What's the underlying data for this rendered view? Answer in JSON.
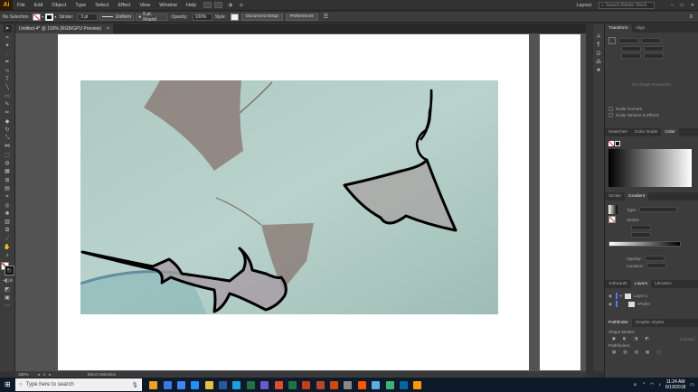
{
  "app": {
    "logo": "Ai",
    "menu": [
      "File",
      "Edit",
      "Object",
      "Type",
      "Select",
      "Effect",
      "View",
      "Window",
      "Help"
    ],
    "workspace": "Layout",
    "search_placeholder": "Search Adobe Stock"
  },
  "control": {
    "selection": "No Selection",
    "stroke_label": "Stroke:",
    "stroke_weight": "3 pt",
    "stroke_profile": "Uniform",
    "brush": "5 pt. Round",
    "opacity_label": "Opacity:",
    "opacity_value": "100%",
    "style_label": "Style:",
    "document_setup": "Document Setup",
    "preferences": "Preferences"
  },
  "document_tab": {
    "title": "Untitled-4* @ 150% (RGB/GPU Preview)",
    "close": "×"
  },
  "status": {
    "zoom": "150%",
    "artboard": "1",
    "tool": "Direct Selection"
  },
  "panels": {
    "transform_tabs": [
      "Transform",
      "Align"
    ],
    "transform_empty": "No Shape Properties",
    "scale_corners": "Scale Corners",
    "scale_strokes": "Scale Strokes & Effects",
    "color_tabs": [
      "Swatches",
      "Color Guide",
      "Color"
    ],
    "stroke_tabs": [
      "Stroke",
      "Gradient"
    ],
    "gradient_type": "Type:",
    "gradient_stroke": "Stroke:",
    "gradient_opacity": "Opacity:",
    "gradient_location": "Location:",
    "layers_tabs": [
      "Artboards",
      "Layers",
      "Libraries"
    ],
    "layers": [
      {
        "name": "Layer 1"
      },
      {
        "name": "<Path>"
      }
    ],
    "pathfinder_tabs": [
      "Pathfinder",
      "Graphic Styles"
    ],
    "shape_modes": "Shape Modes:",
    "pathfinders": "Pathfinders:",
    "expand": "Expand"
  },
  "taskbar": {
    "search_placeholder": "Type here to search",
    "time": "11:24 AM",
    "date": "6/19/2018",
    "icon_colors": [
      "#f0a020",
      "#3b78e7",
      "#4285f4",
      "#1e90ff",
      "#e8c040",
      "#2b579a",
      "#1ba1e2",
      "#1e7145",
      "#6a5acd",
      "#e04c2c",
      "#217346",
      "#c43e1c",
      "#b7472a",
      "#d04a02",
      "#888888",
      "#ff5500",
      "#5dade2",
      "#3cb371",
      "#0a64a4",
      "#ff9a00"
    ]
  }
}
